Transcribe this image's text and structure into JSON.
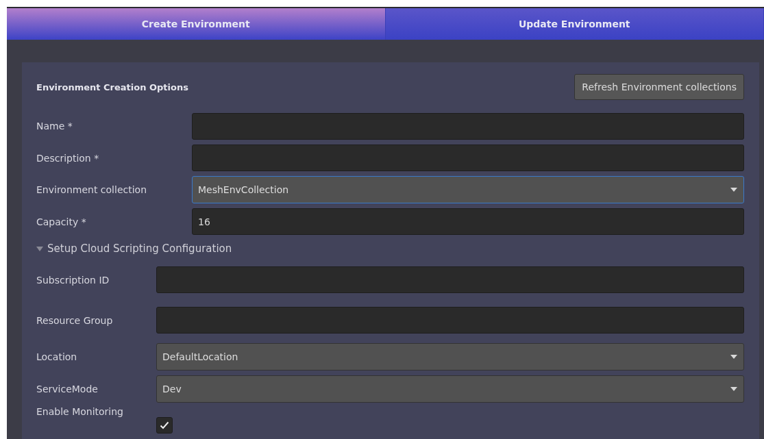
{
  "tabs": [
    {
      "label": "Create Environment",
      "selected": true
    },
    {
      "label": "Update Environment",
      "selected": false
    }
  ],
  "panel": {
    "title": "Environment Creation Options",
    "refresh_button": "Refresh Environment collections",
    "fields": [
      {
        "kind": "text",
        "label": "Name *",
        "focused": false
      },
      {
        "kind": "text",
        "label": "Description *",
        "focused": false
      },
      {
        "kind": "dropdown",
        "label": "Environment collection",
        "value": "MeshEnvCollection",
        "focused": true
      },
      {
        "kind": "text",
        "label": "Capacity *",
        "value": "16",
        "focused": false
      }
    ],
    "foldout": {
      "label": "Setup Cloud Scripting Configuration",
      "expanded": true,
      "fields": [
        {
          "kind": "text",
          "label": "Subscription ID"
        },
        {
          "kind": "text",
          "label": "Resource Group"
        },
        {
          "kind": "dropdown",
          "label": "Location",
          "value": "DefaultLocation"
        },
        {
          "kind": "dropdown",
          "label": "ServiceMode",
          "value": "Dev"
        },
        {
          "kind": "checkbox",
          "label": "Enable Monitoring",
          "checked": true
        }
      ]
    }
  }
}
